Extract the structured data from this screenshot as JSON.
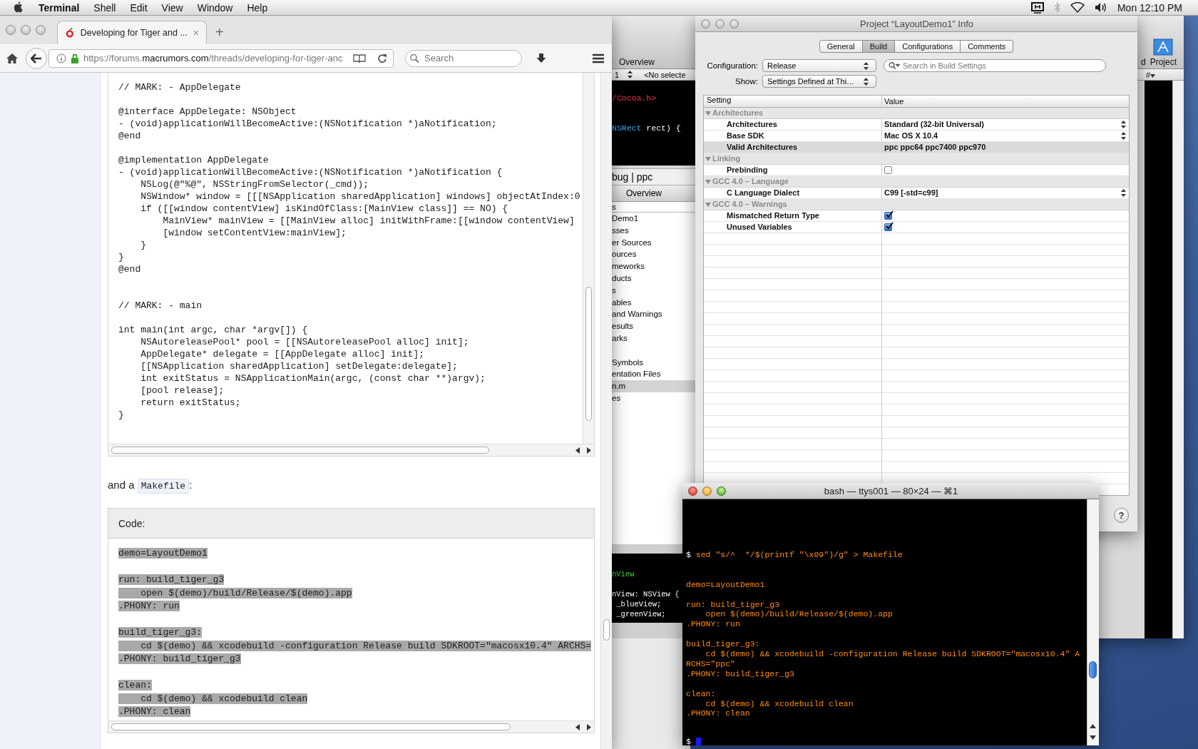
{
  "menubar": {
    "app": "Terminal",
    "menus": [
      "Shell",
      "Edit",
      "View",
      "Window",
      "Help"
    ],
    "clock": "Mon 12:10 PM"
  },
  "browser": {
    "tab": {
      "title": "Developing for Tiger and ...",
      "close": "×"
    },
    "new_tab": "+",
    "url": "https://forums.**macrumors.com**/threads/developing-for-tiger-anc",
    "search": {
      "placeholder": "Search"
    },
    "code_top": "// MARK: - AppDelegate\n\n@interface AppDelegate: NSObject\n- (void)applicationWillBecomeActive:(NSNotification *)aNotification;\n@end\n\n@implementation AppDelegate\n- (void)applicationWillBecomeActive:(NSNotification *)aNotification {\n    NSLog(@\"%@\", NSStringFromSelector(_cmd));\n    NSWindow* window = [[[NSApplication sharedApplication] windows] objectAtIndex:0\n    if ([[window contentView] isKindOfClass:[MainView class]] == NO) {\n        MainView* mainView = [[MainView alloc] initWithFrame:[[window contentView]\n        [window setContentView:mainView];\n    }\n}\n@end\n\n\n// MARK: - main\n\nint main(int argc, char *argv[]) {\n    NSAutoreleasePool* pool = [[NSAutoreleasePool alloc] init];\n    AppDelegate* delegate = [[AppDelegate alloc] init];\n    [[NSApplication sharedApplication] setDelegate:delegate];\n    int exitStatus = NSApplicationMain(argc, (const char **)argv);\n    [pool release];\n    return exitStatus;\n}",
    "text_before": "and a",
    "inline_code": "Makefile",
    "text_after": ":",
    "code_box": {
      "header": "Code:",
      "selected": true,
      "code": "demo=LayoutDemo1\n\nrun: build_tiger_g3\n    open $(demo)/build/Release/$(demo).app\n.PHONY: run\n\nbuild_tiger_g3:\n    cd $(demo) && xcodebuild -configuration Release build SDKROOT=\"macosx10.4\" ARCHS=\n.PHONY: build_tiger_g3\n\nclean:\n    cd $(demo) && xcodebuild clean\n.PHONY: clean"
    }
  },
  "xcode": {
    "toolbar_label": "Overview",
    "toolbar_right_label": "d",
    "project_button": "Project",
    "nav_line": "1",
    "nav_symbol": "<No selecte",
    "nav_popup": "#",
    "editor_top": [
      [
        {
          "kind": "include",
          "text": "/Cocoa.h>"
        }
      ],
      [
        {
          "kind": "type",
          "text": "NSRect"
        },
        {
          "kind": "plain",
          "text": " rect) {"
        }
      ]
    ],
    "target_bar": "bug | ppc",
    "overview_button": "Overview",
    "groups_header": "s",
    "groups": [
      {
        "label": "Demo1",
        "selected": false
      },
      {
        "label": "sses",
        "selected": false
      },
      {
        "label": "er Sources",
        "selected": false
      },
      {
        "label": "ources",
        "selected": false
      },
      {
        "label": "meworks",
        "selected": false
      },
      {
        "label": "ducts",
        "selected": false
      },
      {
        "label": "s",
        "selected": false
      },
      {
        "label": "ables",
        "selected": false
      },
      {
        "label": "and Warnings",
        "selected": false
      },
      {
        "label": "esults",
        "selected": false
      },
      {
        "label": "arks",
        "selected": false
      }
    ],
    "more_groups": [
      {
        "label": "Symbols",
        "selected": false
      },
      {
        "label": "entation Files",
        "selected": false
      },
      {
        "label": "n.m",
        "selected": true
      },
      {
        "label": "es",
        "selected": false
      }
    ],
    "editor_bottom": [
      [
        {
          "kind": "class",
          "text": "nView"
        }
      ],
      [
        {
          "kind": "plain",
          "text": "nView: NSView {"
        }
      ],
      [
        {
          "kind": "plain",
          "text": " _blueView;"
        }
      ],
      [
        {
          "kind": "plain",
          "text": " _greenView;"
        }
      ]
    ]
  },
  "info_window": {
    "title": "Project “LayoutDemo1” Info",
    "tabs": [
      {
        "label": "General",
        "selected": false
      },
      {
        "label": "Build",
        "selected": true
      },
      {
        "label": "Configurations",
        "selected": false
      },
      {
        "label": "Comments",
        "selected": false
      }
    ],
    "configuration": {
      "label": "Configuration:",
      "value": "Release"
    },
    "search": {
      "placeholder": "Search in Build Settings"
    },
    "show": {
      "label": "Show:",
      "value": "Settings Defined at Thi…"
    },
    "columns": [
      "Setting",
      "Value"
    ],
    "groups": [
      {
        "name": "Architectures",
        "expanded": true,
        "settings": [
          {
            "name": "Architectures",
            "kind": "popup",
            "value": "Standard (32-bit Universal)",
            "selected": false
          },
          {
            "name": "Base SDK",
            "kind": "popup",
            "value": "Mac OS X 10.4",
            "selected": false
          },
          {
            "name": "Valid Architectures",
            "kind": "text",
            "value": "ppc ppc64 ppc7400 ppc970",
            "selected": true
          }
        ]
      },
      {
        "name": "Linking",
        "expanded": true,
        "settings": [
          {
            "name": "Prebinding",
            "kind": "checkbox",
            "checked": false,
            "selected": false
          }
        ]
      },
      {
        "name": "GCC 4.0 – Language",
        "expanded": true,
        "settings": [
          {
            "name": "C Language Dialect",
            "kind": "popup",
            "value": "C99 [-std=c99]",
            "selected": false
          }
        ]
      },
      {
        "name": "GCC 4.0 – Warnings",
        "expanded": true,
        "settings": [
          {
            "name": "Mismatched Return Type",
            "kind": "checkbox",
            "checked": true,
            "selected": false
          },
          {
            "name": "Unused Variables",
            "kind": "checkbox",
            "checked": true,
            "selected": false
          }
        ]
      }
    ],
    "help_button": "?"
  },
  "terminal": {
    "title": "bash — ttys001 — 80×24 — ⌘1",
    "prompt": "$",
    "command": "sed \"s/^  */$(printf \"\\x09\")/g\" > Makefile",
    "output": "demo=LayoutDemo1\n\nrun: build_tiger_g3\n    open $(demo)/build/Release/$(demo).app\n.PHONY: run\n\nbuild_tiger_g3:\n    cd $(demo) && xcodebuild -configuration Release build SDKROOT=\"macosx10.4\" A\nRCHS=\"ppc\"\n.PHONY: build_tiger_g3\n\nclean:\n    cd $(demo) && xcodebuild clean\n.PHONY: clean",
    "final_prompt": "$",
    "cursor": true
  }
}
